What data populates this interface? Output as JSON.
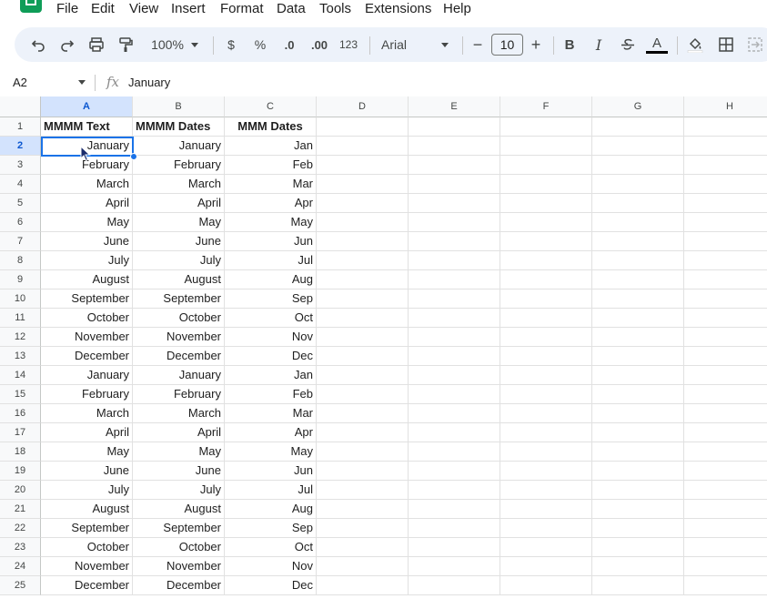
{
  "menu": [
    "File",
    "Edit",
    "View",
    "Insert",
    "Format",
    "Data",
    "Tools",
    "Extensions",
    "Help"
  ],
  "toolbar": {
    "zoom": "100%",
    "currency": "$",
    "percent": "%",
    "decrease_decimal": ".0",
    "increase_decimal": ".00",
    "number_format": "123",
    "font": "Arial",
    "font_size": "10",
    "minus": "−",
    "plus": "+",
    "bold": "B",
    "italic": "I",
    "text_color": "A"
  },
  "formula_bar": {
    "cell_ref": "A2",
    "fx": "fx",
    "value": "January"
  },
  "columns": [
    "A",
    "B",
    "C",
    "D",
    "E",
    "F",
    "G",
    "H"
  ],
  "rows": [
    "1",
    "2",
    "3",
    "4",
    "5",
    "6",
    "7",
    "8",
    "9",
    "10",
    "11",
    "12",
    "13",
    "14",
    "15",
    "16",
    "17",
    "18",
    "19",
    "20",
    "21",
    "22",
    "23",
    "24",
    "25"
  ],
  "selection": {
    "cell": "A2",
    "color": "#1a73e8"
  },
  "cells": [
    [
      "MMMM Text",
      "MMMM Dates",
      "MMM Dates"
    ],
    [
      "January",
      "January",
      "Jan"
    ],
    [
      "February",
      "February",
      "Feb"
    ],
    [
      "March",
      "March",
      "Mar"
    ],
    [
      "April",
      "April",
      "Apr"
    ],
    [
      "May",
      "May",
      "May"
    ],
    [
      "June",
      "June",
      "Jun"
    ],
    [
      "July",
      "July",
      "Jul"
    ],
    [
      "August",
      "August",
      "Aug"
    ],
    [
      "September",
      "September",
      "Sep"
    ],
    [
      "October",
      "October",
      "Oct"
    ],
    [
      "November",
      "November",
      "Nov"
    ],
    [
      "December",
      "December",
      "Dec"
    ],
    [
      "January",
      "January",
      "Jan"
    ],
    [
      "February",
      "February",
      "Feb"
    ],
    [
      "March",
      "March",
      "Mar"
    ],
    [
      "April",
      "April",
      "Apr"
    ],
    [
      "May",
      "May",
      "May"
    ],
    [
      "June",
      "June",
      "Jun"
    ],
    [
      "July",
      "July",
      "Jul"
    ],
    [
      "August",
      "August",
      "Aug"
    ],
    [
      "September",
      "September",
      "Sep"
    ],
    [
      "October",
      "October",
      "Oct"
    ],
    [
      "November",
      "November",
      "Nov"
    ],
    [
      "December",
      "December",
      "Dec"
    ]
  ]
}
